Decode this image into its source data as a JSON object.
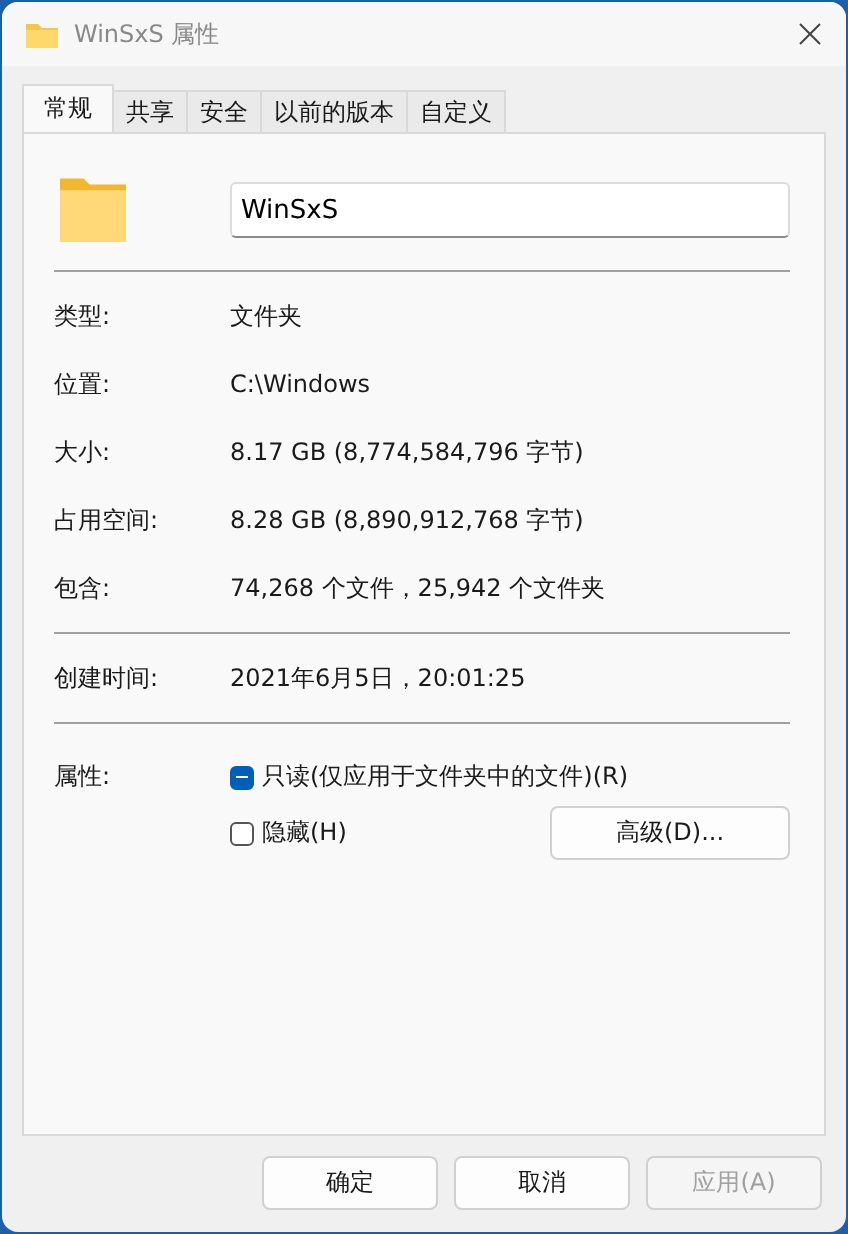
{
  "window": {
    "title": "WinSxS 属性"
  },
  "tabs": [
    {
      "label": "常规",
      "selected": true
    },
    {
      "label": "共享",
      "selected": false
    },
    {
      "label": "安全",
      "selected": false
    },
    {
      "label": "以前的版本",
      "selected": false
    },
    {
      "label": "自定义",
      "selected": false
    }
  ],
  "name_field": {
    "value": "WinSxS"
  },
  "info_groups": [
    [
      {
        "label": "类型:",
        "value": "文件夹"
      },
      {
        "label": "位置:",
        "value": "C:\\Windows"
      },
      {
        "label": "大小:",
        "value": "8.17 GB (8,774,584,796 字节)"
      },
      {
        "label": "占用空间:",
        "value": "8.28 GB (8,890,912,768 字节)"
      },
      {
        "label": "包含:",
        "value": "74,268 个文件，25,942 个文件夹"
      }
    ],
    [
      {
        "label": "创建时间:",
        "value": "2021年6月5日，20:01:25"
      }
    ]
  ],
  "attributes": {
    "label": "属性:",
    "checkboxes": [
      {
        "label": "只读(仅应用于文件夹中的文件)(R)",
        "checked": true,
        "indeterminate": true
      },
      {
        "label": "隐藏(H)",
        "checked": false,
        "indeterminate": false
      }
    ],
    "advanced_button": "高级(D)..."
  },
  "buttons": [
    {
      "label": "确定",
      "disabled": false
    },
    {
      "label": "取消",
      "disabled": false
    },
    {
      "label": "应用(A)",
      "disabled": true
    }
  ]
}
